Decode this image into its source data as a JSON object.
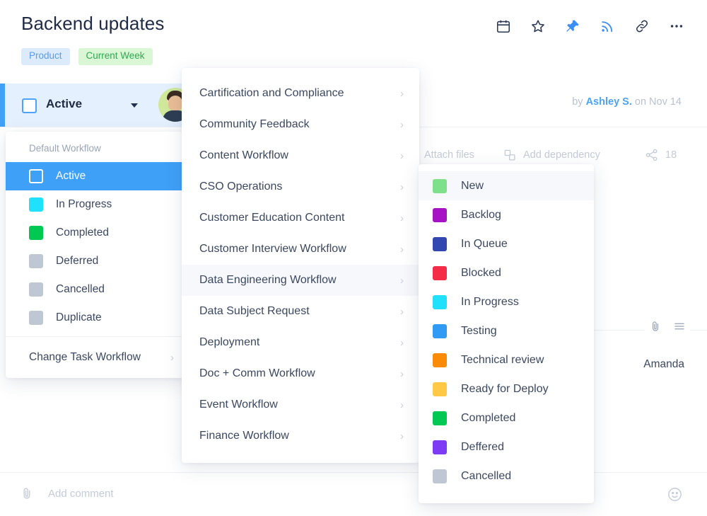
{
  "header": {
    "title": "Backend updates",
    "tags": [
      {
        "label": "Product",
        "color": "#5b9bea",
        "bg": "#dcebfb"
      },
      {
        "label": "Current Week",
        "color": "#32a852",
        "bg": "#d9f7d4"
      }
    ],
    "icons": [
      {
        "name": "calendar-icon",
        "active": false
      },
      {
        "name": "star-icon",
        "active": false
      },
      {
        "name": "pin-icon",
        "active": true
      },
      {
        "name": "rss-follow-icon",
        "active": true
      },
      {
        "name": "link-icon",
        "active": false
      },
      {
        "name": "more-options-icon",
        "active": false
      }
    ]
  },
  "task": {
    "status_label": "Active",
    "byline_prefix": "by",
    "byline_author": "Ashley S.",
    "byline_suffix": "on Nov 14"
  },
  "actions": {
    "attach_files": "Attach files",
    "add_dependency": "Add dependency",
    "share_count": "18"
  },
  "detail": {
    "assignee": "Amanda"
  },
  "comment": {
    "placeholder": "Add comment"
  },
  "workflow_panel": {
    "section_title": "Default Workflow",
    "items": [
      {
        "label": "Active",
        "color": "#3fa0f7",
        "selected": true
      },
      {
        "label": "In Progress",
        "color": "#20e0fb",
        "selected": false
      },
      {
        "label": "Completed",
        "color": "#00c853",
        "selected": false
      },
      {
        "label": "Deferred",
        "color": "#bfc7d4",
        "selected": false
      },
      {
        "label": "Cancelled",
        "color": "#bfc7d4",
        "selected": false
      },
      {
        "label": "Duplicate",
        "color": "#bfc7d4",
        "selected": false
      }
    ],
    "footer": {
      "label": "Change Task Workflow",
      "chevron": "›"
    }
  },
  "workflow_list_panel": {
    "items": [
      {
        "label": "Cartification and Compliance",
        "chevron": "›",
        "hovered": false
      },
      {
        "label": "Community Feedback",
        "chevron": "›",
        "hovered": false
      },
      {
        "label": "Content Workflow",
        "chevron": "›",
        "hovered": false
      },
      {
        "label": "CSO Operations",
        "chevron": "›",
        "hovered": false
      },
      {
        "label": "Customer Education Content",
        "chevron": "›",
        "hovered": false
      },
      {
        "label": "Customer Interview Workflow",
        "chevron": "›",
        "hovered": false
      },
      {
        "label": "Data Engineering Workflow",
        "chevron": "›",
        "hovered": true
      },
      {
        "label": "Data Subject Request",
        "chevron": "›",
        "hovered": false
      },
      {
        "label": "Deployment",
        "chevron": "›",
        "hovered": false
      },
      {
        "label": "Doc + Comm Workflow",
        "chevron": "›",
        "hovered": false
      },
      {
        "label": "Event Workflow",
        "chevron": "›",
        "hovered": false
      },
      {
        "label": "Finance Workflow",
        "chevron": "›",
        "hovered": false
      }
    ]
  },
  "statuses_panel": {
    "items": [
      {
        "label": "New",
        "color": "#7ee08a",
        "hovered": true
      },
      {
        "label": "Backlog",
        "color": "#a613c4",
        "hovered": false
      },
      {
        "label": "In Queue",
        "color": "#3347b0",
        "hovered": false
      },
      {
        "label": "Blocked",
        "color": "#f42c47",
        "hovered": false
      },
      {
        "label": "In Progress",
        "color": "#20e0fb",
        "hovered": false
      },
      {
        "label": "Testing",
        "color": "#2f9bf5",
        "hovered": false
      },
      {
        "label": "Technical review",
        "color": "#fb8a06",
        "hovered": false
      },
      {
        "label": "Ready for Deploy",
        "color": "#ffc945",
        "hovered": false
      },
      {
        "label": "Completed",
        "color": "#00c853",
        "hovered": false
      },
      {
        "label": "Deffered",
        "color": "#7d3bf5",
        "hovered": false
      },
      {
        "label": "Cancelled",
        "color": "#bfc7d4",
        "hovered": false
      }
    ]
  }
}
